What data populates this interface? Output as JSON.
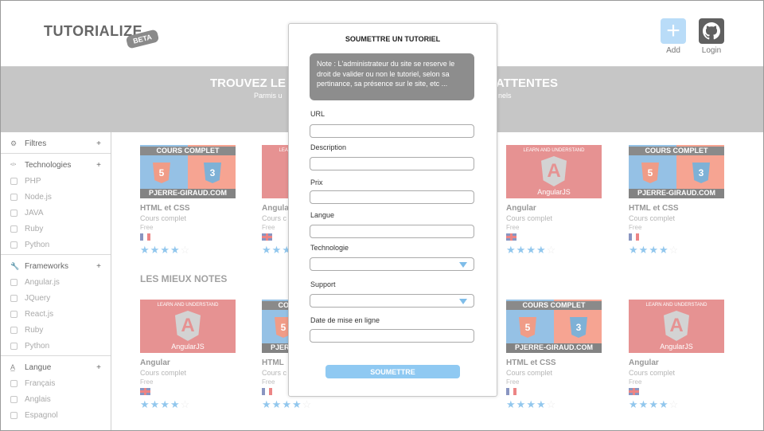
{
  "header": {
    "logo": "TUTORIALIZE",
    "beta": "BETA",
    "add_label": "Add",
    "login_label": "Login"
  },
  "banner": {
    "title_left": "TROUVEZ LE",
    "title_right": "ATTENTES",
    "subtitle_left": "Parmis u",
    "subtitle_right": "nels"
  },
  "sidebar": {
    "filters": "Filtres",
    "plus": "+",
    "technologies": {
      "title": "Technologies",
      "items": [
        "PHP",
        "Node.js",
        "JAVA",
        "Ruby",
        "Python"
      ]
    },
    "frameworks": {
      "title": "Frameworks",
      "items": [
        "Angular.js",
        "JQuery",
        "React.js",
        "Ruby",
        "Python"
      ]
    },
    "languages": {
      "title": "Langue",
      "items": [
        "Français",
        "Anglais",
        "Espagnol"
      ]
    }
  },
  "content": {
    "best_rated_title": "LES MIEUX NOTES",
    "thumb_html": {
      "band": "COURS COMPLET",
      "foot": "PJERRE-GIRAUD.COM",
      "html": "HTML",
      "css": "CSS"
    },
    "thumb_angular": {
      "tag": "LEARN AND UNDERSTAND",
      "name": "AngularJS",
      "letter": "A"
    },
    "cards": [
      {
        "title": "HTML et CSS",
        "type": "Cours complet",
        "price": "Free",
        "lang": "fr",
        "rating": 4,
        "thumb": "html"
      },
      {
        "title": "Angula",
        "type": "Cours c",
        "price": "Free",
        "lang": "gb",
        "rating": 4,
        "thumb": "angular"
      },
      {
        "title": "Angular",
        "type": "Cours complet",
        "price": "Free",
        "lang": "gb",
        "rating": 4,
        "thumb": "angular"
      },
      {
        "title": "HTML et CSS",
        "type": "Cours complet",
        "price": "Free",
        "lang": "fr",
        "rating": 4,
        "thumb": "html"
      },
      {
        "title": "Angular",
        "type": "Cours complet",
        "price": "Free",
        "lang": "gb",
        "rating": 4,
        "thumb": "angular"
      },
      {
        "title": "HTML",
        "type": "Cours c",
        "price": "Free",
        "lang": "fr",
        "rating": 4,
        "thumb": "html"
      },
      {
        "title": "",
        "type": "",
        "price": "",
        "lang": "gb",
        "rating": 4,
        "thumb": "none"
      },
      {
        "title": "HTML et CSS",
        "type": "Cours complet",
        "price": "Free",
        "lang": "fr",
        "rating": 4,
        "thumb": "html"
      },
      {
        "title": "Angular",
        "type": "Cours complet",
        "price": "Free",
        "lang": "gb",
        "rating": 4,
        "thumb": "angular"
      }
    ]
  },
  "modal": {
    "title": "SOUMETTRE UN TUTORIEL",
    "note": "Note : L'administrateur du site se reserve le droit de valider ou non le tutoriel, selon sa pertinance, sa présence sur le site, etc ...",
    "url_label": "URL",
    "url_value": "",
    "description_label": "Description",
    "description_value": "",
    "price_label": "Prix",
    "price_value": "",
    "language_label": "Langue",
    "language_value": "",
    "technology_label": "Technologie",
    "support_label": "Support",
    "date_label": "Date de mise en ligne",
    "date_value": "",
    "submit_label": "SOUMETTRE"
  },
  "colors": {
    "accent": "#8fc9f2",
    "star": "#3a9be0",
    "banner": "#c6c6c6",
    "note_bg": "#8d8d8d"
  }
}
